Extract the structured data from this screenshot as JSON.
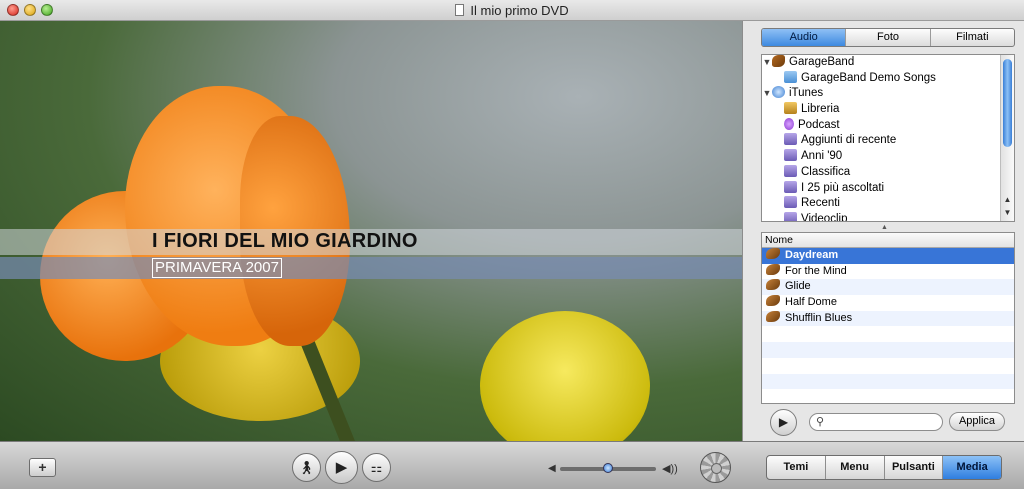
{
  "window": {
    "title": "Il mio primo DVD"
  },
  "preview": {
    "main_title": "I FIORI DEL MIO GIARDINO",
    "subtitle": "PRIMAVERA 2007",
    "watermark_icon": "apple-logo-icon"
  },
  "media_tabs": [
    "Audio",
    "Foto",
    "Filmati"
  ],
  "media_tab_active": "Audio",
  "source_tree": [
    {
      "label": "GarageBand",
      "icon": "guitar-icon",
      "level": 0,
      "expanded": true
    },
    {
      "label": "GarageBand Demo Songs",
      "icon": "folder-icon",
      "level": 1
    },
    {
      "label": "iTunes",
      "icon": "itunes-icon",
      "level": 0,
      "expanded": true
    },
    {
      "label": "Libreria",
      "icon": "library-icon",
      "level": 1
    },
    {
      "label": "Podcast",
      "icon": "podcast-icon",
      "level": 1
    },
    {
      "label": "Aggiunti di recente",
      "icon": "smart-playlist-icon",
      "level": 1
    },
    {
      "label": "Anni '90",
      "icon": "smart-playlist-icon",
      "level": 1
    },
    {
      "label": "Classifica",
      "icon": "smart-playlist-icon",
      "level": 1
    },
    {
      "label": "I 25 più ascoltati",
      "icon": "smart-playlist-icon",
      "level": 1
    },
    {
      "label": "Recenti",
      "icon": "smart-playlist-icon",
      "level": 1
    },
    {
      "label": "Videoclip",
      "icon": "smart-playlist-icon",
      "level": 1
    }
  ],
  "song_list": {
    "column_header": "Nome",
    "rows": [
      "Daydream",
      "For the Mind",
      "Glide",
      "Half Dome",
      "Shufflin Blues"
    ],
    "selected": "Daydream"
  },
  "search": {
    "value": "",
    "placeholder": ""
  },
  "apply_label": "Applica",
  "bottom_tabs": [
    "Temi",
    "Menu",
    "Pulsanti",
    "Media"
  ],
  "bottom_tab_active": "Media",
  "colors": {
    "selection": "#3875d7",
    "accent_tab": "#3d89e0"
  }
}
